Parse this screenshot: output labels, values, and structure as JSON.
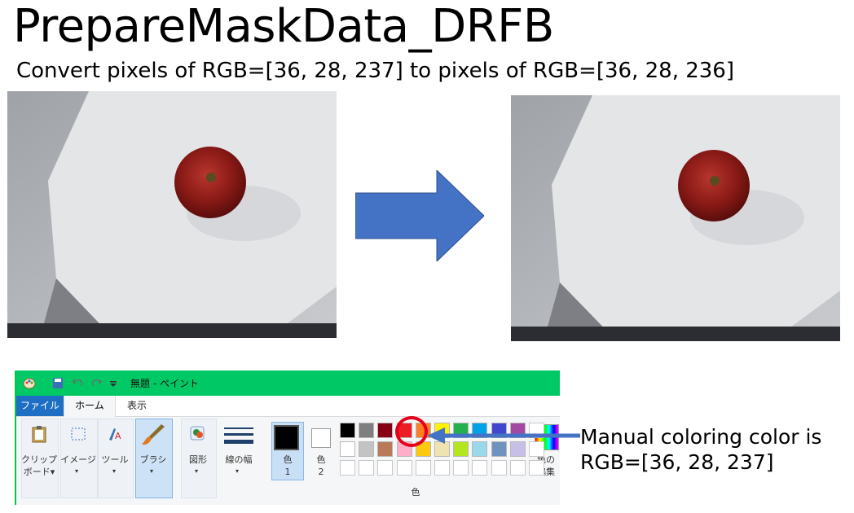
{
  "heading": {
    "title": "PrepareMaskData_DRFB",
    "subtitle": "Convert pixels of RGB=[36, 28, 237] to pixels of RGB=[36, 28, 236]"
  },
  "paint": {
    "window_title": "無題 - ペイント",
    "tabs": [
      "ファイル",
      "ホーム",
      "表示"
    ],
    "groups": {
      "clipboard_1": "クリップ",
      "clipboard_2": "ボード▾",
      "image": "イメージ",
      "tools": "ツール",
      "brush": "ブラシ",
      "shapes": "図形",
      "line_width": "線の幅",
      "color1_1": "色",
      "color1_2": "1",
      "color2_1": "色",
      "color2_2": "2",
      "edit_colors_1": "色の",
      "edit_colors_2": "編集",
      "colors_group": "色"
    },
    "palette_row1": [
      "#000000",
      "#7f7f7f",
      "#880015",
      "#ed1c24",
      "#ff7f27",
      "#fff200",
      "#22b14c",
      "#00a2e8",
      "#3f48cc",
      "#a349a4"
    ],
    "palette_row2": [
      "#ffffff",
      "#c3c3c3",
      "#b97a57",
      "#ffaec9",
      "#ffc90e",
      "#efe4b0",
      "#b5e61d",
      "#99d9ea",
      "#7092be",
      "#c8bfe7"
    ],
    "color1": "#000000",
    "color2": "#ffffff",
    "highlight_color": "#e4001a",
    "titlebar_color": "#00c864"
  },
  "annotation": {
    "line1": "Manual coloring color is",
    "line2": "RGB=[36, 28, 237]"
  },
  "colors": {
    "arrow_fill": "#4472c4",
    "photo_background": "#4a4b50"
  }
}
